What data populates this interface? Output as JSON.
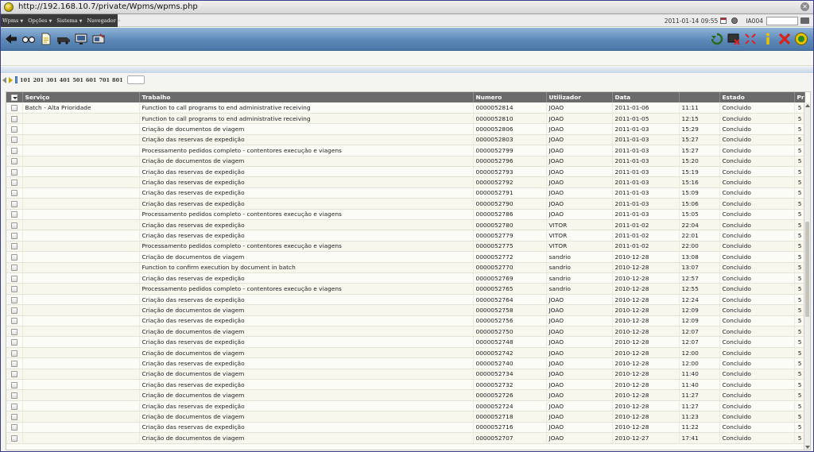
{
  "browser": {
    "url": "http://192.168.10.7/private/Wpms/wpms.php"
  },
  "menu": [
    {
      "label": "Wpms"
    },
    {
      "label": "Opções"
    },
    {
      "label": "Sistema"
    },
    {
      "label": "Navegador"
    }
  ],
  "header": {
    "datetime": "2011-01-14 09:55",
    "user_code": "IA004"
  },
  "toolbar_left_icons": [
    "back-arrow-icon",
    "glasses-icon",
    "document-icon",
    "bus-icon",
    "monitor-icon",
    "tools-monitor-icon"
  ],
  "toolbar_right_icons": [
    "refresh-icon",
    "monitor-x-icon",
    "fullscreen-icon",
    "info-icon",
    "close-icon",
    "exit-icon"
  ],
  "pager": {
    "pages": [
      "101",
      "201",
      "301",
      "401",
      "501",
      "601",
      "701",
      "801"
    ]
  },
  "table": {
    "columns": [
      "",
      "Serviço",
      "Trabalho",
      "Numero",
      "Utilizador",
      "Data",
      "",
      "Estado",
      "Pri."
    ],
    "rows": [
      [
        "Batch - Alta Prioridade",
        "Function to call programs to end administrative receiving",
        "0000052814",
        "JOAO",
        "2011-01-06",
        "11:11",
        "Concluido",
        "5"
      ],
      [
        "",
        "Function to call programs to end administrative receiving",
        "0000052810",
        "JOAO",
        "2011-01-05",
        "12:15",
        "Concluido",
        "5"
      ],
      [
        "",
        "Criação de documentos de viagem",
        "0000052806",
        "JOAO",
        "2011-01-03",
        "15:29",
        "Concluido",
        "5"
      ],
      [
        "",
        "Criação das reservas de expedição",
        "0000052803",
        "JOAO",
        "2011-01-03",
        "15:27",
        "Concluido",
        "5"
      ],
      [
        "",
        "Processamento pedidos completo - contentores execução e viagens",
        "0000052799",
        "JOAO",
        "2011-01-03",
        "15:27",
        "Concluido",
        "5"
      ],
      [
        "",
        "Criação de documentos de viagem",
        "0000052796",
        "JOAO",
        "2011-01-03",
        "15:20",
        "Concluido",
        "5"
      ],
      [
        "",
        "Criação das reservas de expedição",
        "0000052793",
        "JOAO",
        "2011-01-03",
        "15:19",
        "Concluido",
        "5"
      ],
      [
        "",
        "Criação das reservas de expedição",
        "0000052792",
        "JOAO",
        "2011-01-03",
        "15:16",
        "Concluido",
        "5"
      ],
      [
        "",
        "Criação das reservas de expedição",
        "0000052791",
        "JOAO",
        "2011-01-03",
        "15:09",
        "Concluido",
        "5"
      ],
      [
        "",
        "Criação das reservas de expedição",
        "0000052790",
        "JOAO",
        "2011-01-03",
        "15:06",
        "Concluido",
        "5"
      ],
      [
        "",
        "Processamento pedidos completo - contentores execução e viagens",
        "0000052786",
        "JOAO",
        "2011-01-03",
        "15:05",
        "Concluido",
        "5"
      ],
      [
        "",
        "Criação das reservas de expedição",
        "0000052780",
        "VITOR",
        "2011-01-02",
        "22:04",
        "Concluido",
        "5"
      ],
      [
        "",
        "Criação das reservas de expedição",
        "0000052779",
        "VITOR",
        "2011-01-02",
        "22:01",
        "Concluido",
        "5"
      ],
      [
        "",
        "Processamento pedidos completo - contentores execução e viagens",
        "0000052775",
        "VITOR",
        "2011-01-02",
        "22:00",
        "Concluido",
        "5"
      ],
      [
        "",
        "Criação de documentos de viagem",
        "0000052772",
        "sandrio",
        "2010-12-28",
        "13:08",
        "Concluido",
        "5"
      ],
      [
        "",
        "Function to confirm execution by document in batch",
        "0000052770",
        "sandrio",
        "2010-12-28",
        "13:07",
        "Concluido",
        "5"
      ],
      [
        "",
        "Criação das reservas de expedição",
        "0000052769",
        "sandrio",
        "2010-12-28",
        "12:57",
        "Concluido",
        "5"
      ],
      [
        "",
        "Processamento pedidos completo - contentores execução e viagens",
        "0000052765",
        "sandrio",
        "2010-12-28",
        "12:55",
        "Concluido",
        "5"
      ],
      [
        "",
        "Criação das reservas de expedição",
        "0000052764",
        "JOAO",
        "2010-12-28",
        "12:24",
        "Concluido",
        "5"
      ],
      [
        "",
        "Criação de documentos de viagem",
        "0000052758",
        "JOAO",
        "2010-12-28",
        "12:09",
        "Concluido",
        "5"
      ],
      [
        "",
        "Criação das reservas de expedição",
        "0000052756",
        "JOAO",
        "2010-12-28",
        "12:09",
        "Concluido",
        "5"
      ],
      [
        "",
        "Criação de documentos de viagem",
        "0000052750",
        "JOAO",
        "2010-12-28",
        "12:07",
        "Concluido",
        "5"
      ],
      [
        "",
        "Criação das reservas de expedição",
        "0000052748",
        "JOAO",
        "2010-12-28",
        "12:07",
        "Concluido",
        "5"
      ],
      [
        "",
        "Criação de documentos de viagem",
        "0000052742",
        "JOAO",
        "2010-12-28",
        "12:00",
        "Concluido",
        "5"
      ],
      [
        "",
        "Criação das reservas de expedição",
        "0000052740",
        "JOAO",
        "2010-12-28",
        "12:00",
        "Concluido",
        "5"
      ],
      [
        "",
        "Criação de documentos de viagem",
        "0000052734",
        "JOAO",
        "2010-12-28",
        "11:40",
        "Concluido",
        "5"
      ],
      [
        "",
        "Criação das reservas de expedição",
        "0000052732",
        "JOAO",
        "2010-12-28",
        "11:40",
        "Concluido",
        "5"
      ],
      [
        "",
        "Criação de documentos de viagem",
        "0000052726",
        "JOAO",
        "2010-12-28",
        "11:27",
        "Concluido",
        "5"
      ],
      [
        "",
        "Criação das reservas de expedição",
        "0000052724",
        "JOAO",
        "2010-12-28",
        "11:27",
        "Concluido",
        "5"
      ],
      [
        "",
        "Criação de documentos de viagem",
        "0000052718",
        "JOAO",
        "2010-12-28",
        "11:23",
        "Concluido",
        "5"
      ],
      [
        "",
        "Criação das reservas de expedição",
        "0000052716",
        "JOAO",
        "2010-12-28",
        "11:22",
        "Concluido",
        "5"
      ],
      [
        "",
        "Criação de documentos de viagem",
        "0000052707",
        "JOAO",
        "2010-12-27",
        "17:41",
        "Concluido",
        "5"
      ]
    ]
  }
}
